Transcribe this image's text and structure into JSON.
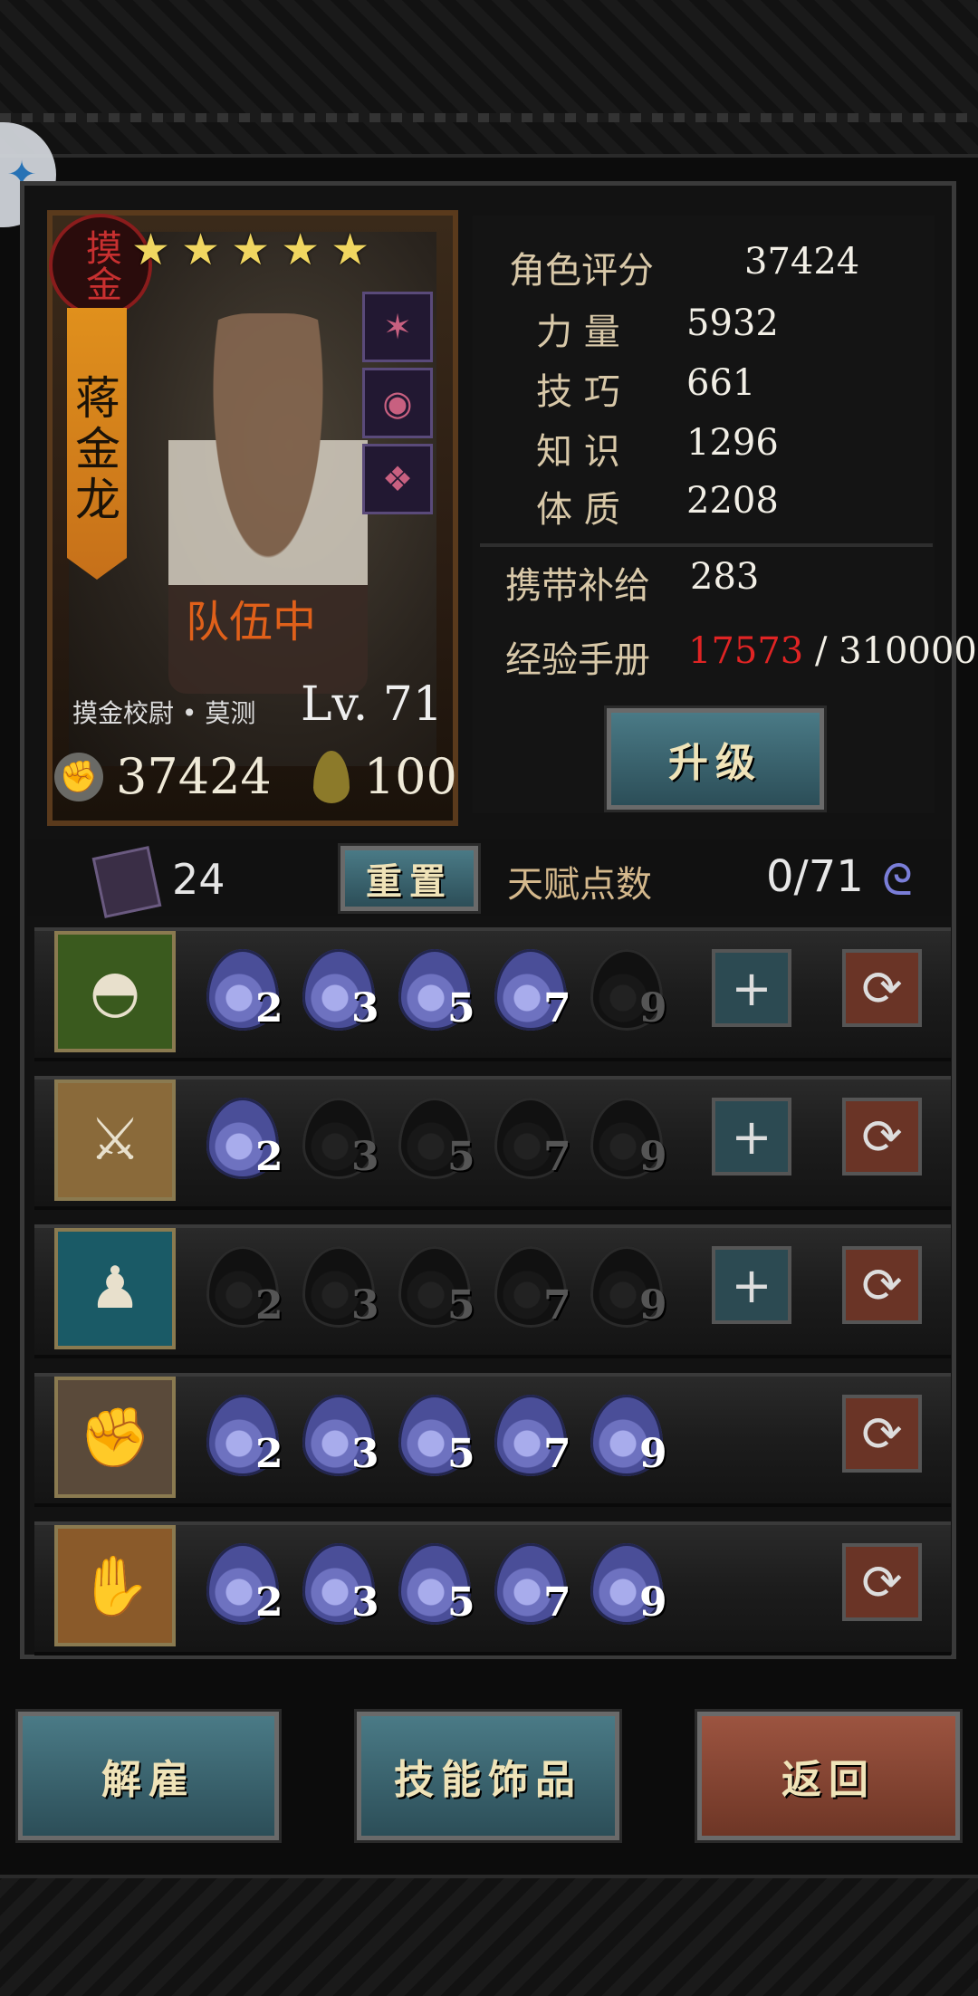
{
  "hero": {
    "seal": "摸金",
    "name": "蒋金龙",
    "stars": [
      "★",
      "★",
      "★",
      "★",
      "★"
    ],
    "team_status": "队伍中",
    "class_name": "摸金校尉 • 莫测",
    "level": "Lv. 71",
    "power": "37424",
    "stamina": "100",
    "equipment": [
      {
        "icon": "scorpion-icon",
        "glyph": "✶"
      },
      {
        "icon": "ring-icon",
        "glyph": "◉"
      },
      {
        "icon": "amulet-icon",
        "glyph": "❖"
      }
    ]
  },
  "stats": {
    "rating_label": "角色评分",
    "rating": "37424",
    "strength_label": "力 量",
    "strength": "5932",
    "skill_label": "技 巧",
    "skill": "661",
    "knowledge_label": "知 识",
    "knowledge": "1296",
    "constitution_label": "体 质",
    "constitution": "2208",
    "supply_label": "携带补给",
    "supply": "283",
    "exp_label": "经验手册",
    "exp_current": "17573",
    "exp_sep": " / ",
    "exp_total": "310000",
    "upgrade_label": "升级"
  },
  "talent": {
    "book_count": "24",
    "reset_label": "重置",
    "points_label": "天赋点数",
    "points": "0/71",
    "colors": {
      "active_flame": "#6e72c0",
      "inactive_flame": "#181818"
    }
  },
  "skills": [
    {
      "icon": "cat-eyes-icon",
      "nodes": [
        "2",
        "3",
        "5",
        "7",
        "9"
      ],
      "active": 4,
      "has_plus": true
    },
    {
      "icon": "blade-slash-icon",
      "nodes": [
        "2",
        "3",
        "5",
        "7",
        "9"
      ],
      "active": 1,
      "has_plus": true
    },
    {
      "icon": "shadow-figure-icon",
      "nodes": [
        "2",
        "3",
        "5",
        "7",
        "9"
      ],
      "active": 0,
      "has_plus": true
    },
    {
      "icon": "muscle-icon",
      "nodes": [
        "2",
        "3",
        "5",
        "7",
        "9"
      ],
      "active": 5,
      "has_plus": false
    },
    {
      "icon": "scroll-hand-icon",
      "nodes": [
        "2",
        "3",
        "5",
        "7",
        "9"
      ],
      "active": 5,
      "has_plus": false
    }
  ],
  "bottom": {
    "dismiss_label": "解雇",
    "accessory_label": "技能饰品",
    "back_label": "返回"
  }
}
